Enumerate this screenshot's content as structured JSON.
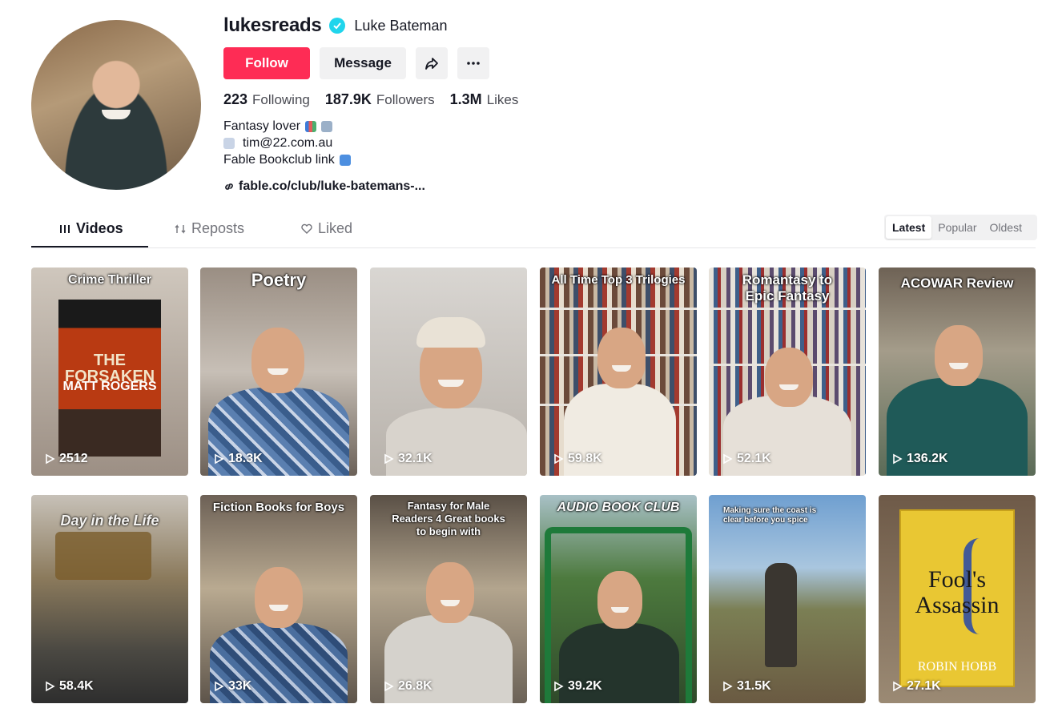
{
  "profile": {
    "username": "lukesreads",
    "nickname": "Luke Bateman",
    "follow_label": "Follow",
    "message_label": "Message",
    "stats": [
      {
        "value": "223",
        "label": "Following"
      },
      {
        "value": "187.9K",
        "label": "Followers"
      },
      {
        "value": "1.3M",
        "label": "Likes"
      }
    ],
    "bio": {
      "line1": "Fantasy lover",
      "line2": "tim@22.com.au",
      "line3": "Fable Bookclub link"
    },
    "link": "fable.co/club/luke-batemans-..."
  },
  "tabs": [
    {
      "label": "Videos",
      "icon": "grid-icon"
    },
    {
      "label": "Reposts",
      "icon": "repost-icon"
    },
    {
      "label": "Liked",
      "icon": "heart-icon"
    }
  ],
  "sort": [
    "Latest",
    "Popular",
    "Oldest"
  ],
  "videos": [
    {
      "title": "Crime Thriller",
      "views": "2512",
      "book_title": "THE FORSAKEN",
      "book_author": "MATT ROGERS"
    },
    {
      "title": "Poetry",
      "views": "18.3K"
    },
    {
      "title": "",
      "views": "32.1K"
    },
    {
      "title": "All Time Top 3 Trilogies",
      "views": "59.8K"
    },
    {
      "title": "Romantasy to Epic Fantasy",
      "views": "52.1K"
    },
    {
      "title": "ACOWAR Review",
      "views": "136.2K"
    },
    {
      "title": "Day in the Life",
      "views": "58.4K"
    },
    {
      "title": "Fiction Books for Boys",
      "views": "33K"
    },
    {
      "title": "Fantasy for Male Readers 4 Great books to begin with",
      "views": "26.8K"
    },
    {
      "title": "AUDIO BOOK CLUB",
      "views": "39.2K"
    },
    {
      "title": "Making sure the coast is clear before you spice",
      "views": "31.5K"
    },
    {
      "title": "",
      "views": "27.1K",
      "book_title": "Fool's Assassin",
      "book_author": "ROBIN HOBB"
    }
  ],
  "colors": {
    "accent": "#fe2c55",
    "verified": "#20d5ec"
  }
}
